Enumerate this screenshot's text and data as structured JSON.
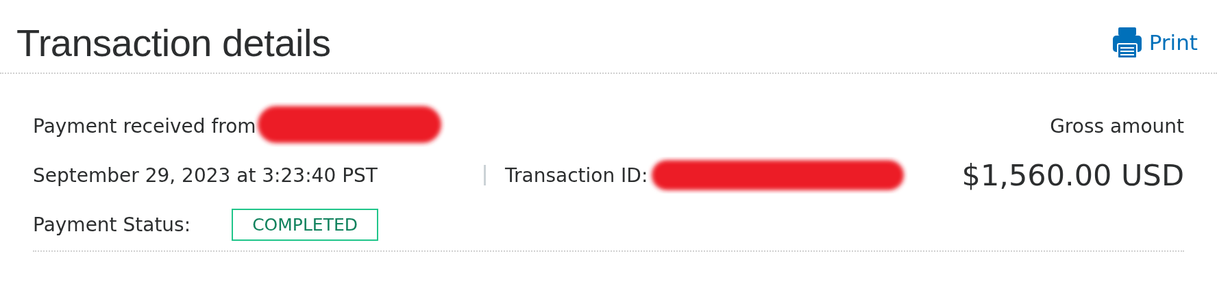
{
  "header": {
    "title": "Transaction details",
    "print_label": "Print"
  },
  "details": {
    "received_label": "Payment received from",
    "payer_redacted": true,
    "date": "September 29, 2023 at 3:23:40 PST",
    "transaction_id_label": "Transaction ID:",
    "transaction_id_redacted": true,
    "status_label": "Payment Status:",
    "status": "COMPLETED",
    "gross_label": "Gross amount",
    "gross_amount": "$1,560.00 USD"
  }
}
